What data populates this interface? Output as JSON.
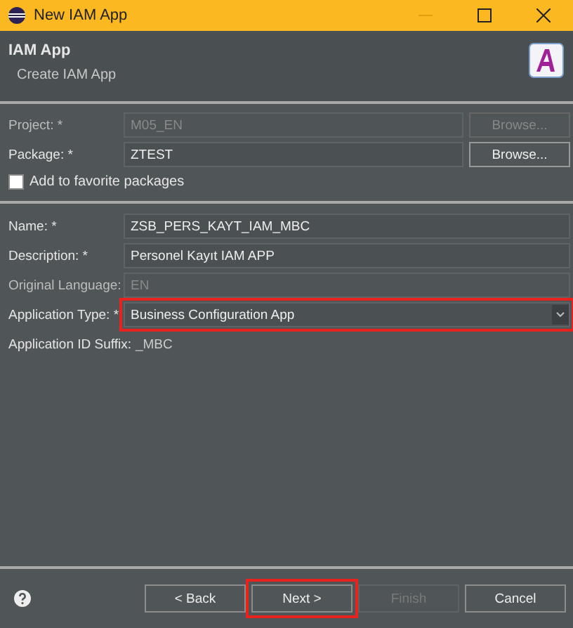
{
  "window": {
    "title": "New IAM App"
  },
  "header": {
    "title": "IAM App",
    "subtitle": "Create IAM App"
  },
  "project_rows": [
    {
      "label": "Project: *",
      "value": "M05_EN",
      "disabled": true,
      "button": "Browse...",
      "button_disabled": true
    },
    {
      "label": "Package: *",
      "value": "ZTEST",
      "disabled": false,
      "button": "Browse...",
      "button_disabled": false
    }
  ],
  "favorite_checkbox": {
    "label": "Add to favorite packages",
    "checked": false
  },
  "fields": [
    {
      "kind": "text",
      "label": "Name: *",
      "value": "ZSB_PERS_KAYT_IAM_MBC",
      "disabled": false,
      "highlighted": false
    },
    {
      "kind": "text",
      "label": "Description: *",
      "value": "Personel Kayıt IAM APP",
      "disabled": false,
      "highlighted": false
    },
    {
      "kind": "text",
      "label": "Original Language:",
      "value": "EN",
      "disabled": true,
      "highlighted": false
    },
    {
      "kind": "combo",
      "label": "Application Type: *",
      "value": "Business Configuration App",
      "disabled": false,
      "highlighted": true
    },
    {
      "kind": "static",
      "label": "Application ID Suffix:",
      "value": "_MBC"
    }
  ],
  "buttons": [
    {
      "label": "< Back",
      "disabled": false,
      "highlighted": false
    },
    {
      "label": "Next >",
      "disabled": false,
      "highlighted": true
    },
    {
      "label": "Finish",
      "disabled": true,
      "highlighted": false
    },
    {
      "label": "Cancel",
      "disabled": false,
      "highlighted": false
    }
  ]
}
